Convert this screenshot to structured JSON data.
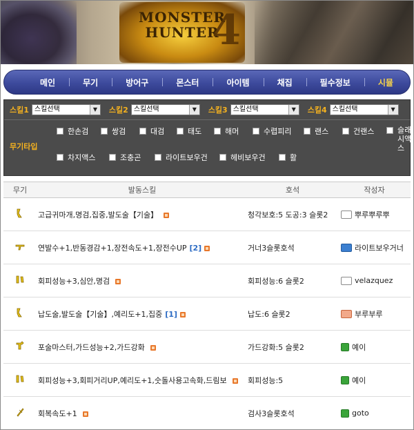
{
  "banner": {
    "logo_line1": "MONSTER",
    "logo_line2": "HUNTER",
    "logo_number": "4"
  },
  "nav": {
    "items": [
      {
        "label": "메인"
      },
      {
        "label": "무기"
      },
      {
        "label": "방어구"
      },
      {
        "label": "몬스터"
      },
      {
        "label": "아이템"
      },
      {
        "label": "채집"
      },
      {
        "label": "필수정보"
      },
      {
        "label": "시뮬"
      }
    ],
    "active_index": 7,
    "active_color": "#f5d24a"
  },
  "filters": {
    "skills": [
      {
        "label": "스킬1",
        "value": "스킬선택"
      },
      {
        "label": "스킬2",
        "value": "스킬선택"
      },
      {
        "label": "스킬3",
        "value": "스킬선택"
      },
      {
        "label": "스킬4",
        "value": "스킬선택"
      }
    ],
    "weapon_type_label": "무기타입",
    "weapon_types": [
      "한손검",
      "쌍검",
      "대검",
      "태도",
      "해머",
      "수렵피리",
      "랜스",
      "건랜스",
      "슬래시액스",
      "차지액스",
      "조충곤",
      "라이트보우건",
      "헤비보우건",
      "활"
    ],
    "label_color": "#f5b21f"
  },
  "table": {
    "headers": {
      "weapon": "무기",
      "skills": "발동스킬",
      "charm": "호석",
      "author": "작성자"
    },
    "rows": [
      {
        "weapon_icon": "sword-icon",
        "skills": "고급귀마개,명검,집중,발도술【기술】",
        "count": "",
        "charm": "청각보호:5 도공:3 슬롯2",
        "author": "뿌루뿌루뿌",
        "author_badge": "plain"
      },
      {
        "weapon_icon": "bowgun-icon",
        "skills": "연발수+1,반동경감+1,장전속도+1,장전수UP",
        "count": "[2]",
        "charm": "거너3슬롯호석",
        "author": "라이트보우거너",
        "author_badge": "blue"
      },
      {
        "weapon_icon": "dual-blades-icon",
        "skills": "회피성능+3,심안,명검",
        "count": "",
        "charm": "회피성능:6 슬롯2",
        "author": "velazquez",
        "author_badge": "plain"
      },
      {
        "weapon_icon": "sword-icon",
        "skills": "납도술,발도술【기술】,예리도+1,집중",
        "count": "[1]",
        "charm": "납도:6 슬롯2",
        "author": "부루부루",
        "author_badge": "orange"
      },
      {
        "weapon_icon": "gunlance-icon",
        "skills": "포술마스터,가드성능+2,가드강화",
        "count": "",
        "charm": "가드강화:5 슬롯2",
        "author": "예이",
        "author_badge": "green"
      },
      {
        "weapon_icon": "dual-blades-icon",
        "skills": "회피성능+3,회피거리UP,예리도+1,숫돌사용고속화,드림보",
        "count": "",
        "charm": "회피성능:5",
        "author": "예이",
        "author_badge": "green"
      },
      {
        "weapon_icon": "bow-icon",
        "skills": "회복속도+1",
        "count": "",
        "charm": "검사3슬롯호석",
        "author": "goto",
        "author_badge": "green"
      }
    ]
  }
}
